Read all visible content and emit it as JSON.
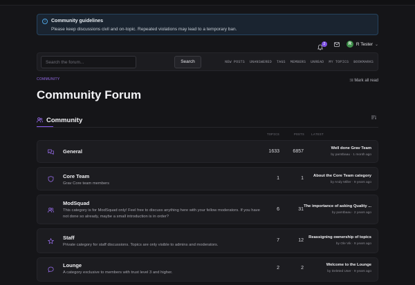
{
  "notice": {
    "title": "Community guidelines",
    "text": "Please keep discussions civil and on-topic. Repeated violations may lead to a temporary ban."
  },
  "user": {
    "notification_count": "2",
    "avatar_initial": "R",
    "name": "R Tester"
  },
  "search": {
    "placeholder": "Search the forum...",
    "button": "Search"
  },
  "nav": [
    "NEW POSTS",
    "UNANSWERED",
    "TAGS",
    "MEMBERS",
    "UNREAD",
    "MY TOPICS",
    "BOOKMARKS"
  ],
  "breadcrumb": "COMMUNITY",
  "mark_all_read": "Mark all read",
  "page_title": "Community Forum",
  "section": {
    "title": "Community",
    "columns": {
      "topics": "TOPICS",
      "posts": "POSTS",
      "latest": "LATEST"
    }
  },
  "categories": [
    {
      "name": "General",
      "description": "",
      "topics": "1633",
      "posts": "6857",
      "latest_title": "Well done Grav Team",
      "latest_meta": "by pamtbaau · 1 month ago",
      "icon": "chat-bubbles-icon",
      "icon_color": "#9b6ef0"
    },
    {
      "name": "Core Team",
      "description": "Grav Core team members",
      "topics": "1",
      "posts": "1",
      "latest_title": "About the Core Team category",
      "latest_meta": "by Andy Miller · 9 years ago",
      "icon": "shield-icon",
      "icon_color": "#9b6ef0"
    },
    {
      "name": "ModSquad",
      "description": "This category is for ModSquad only! Feel free to discuss anything here with your fellow moderators. If you have not done so already, maybe a small introduction is in order?",
      "topics": "6",
      "posts": "31",
      "latest_title": "The importance of asking Quality ...",
      "latest_meta": "by pamtbaau · 2 years ago",
      "icon": "users-icon",
      "icon_color": "#9b6ef0"
    },
    {
      "name": "Staff",
      "description": "Private category for staff discussions. Topics are only visible to admins and moderators.",
      "topics": "7",
      "posts": "12",
      "latest_title": "Reassigning ownership of topics",
      "latest_meta": "by Ole Vik · 9 years ago",
      "icon": "star-icon",
      "icon_color": "#9b6ef0"
    },
    {
      "name": "Lounge",
      "description": "A category exclusive to members with trust level 3 and higher.",
      "topics": "2",
      "posts": "2",
      "latest_title": "Welcome to the Lounge",
      "latest_meta": "by Deleted User · 9 years ago",
      "icon": "chat-bubble-icon",
      "icon_color": "#9b6ef0"
    }
  ],
  "colors": {
    "accent": "#8a5cf0",
    "notice_border": "#26445f",
    "avatar": "#3f8f4a"
  }
}
